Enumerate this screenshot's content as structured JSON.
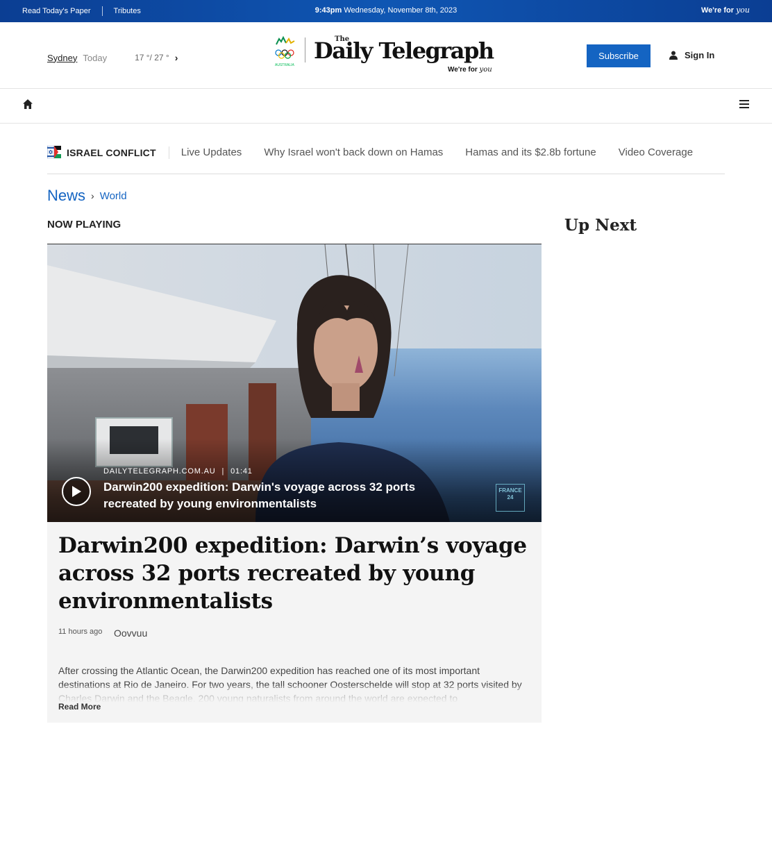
{
  "topbar": {
    "read_paper": "Read Today's Paper",
    "tributes": "Tributes",
    "time": "9:43pm",
    "date": "Wednesday, November 8th, 2023",
    "tagline_prefix": "We're for",
    "tagline_script": "you"
  },
  "masthead": {
    "city": "Sydney",
    "day": "Today",
    "temps": "17 °/ 27 °",
    "olympic_text": "AUSTRALIA",
    "logo_the": "The",
    "logo_name": "Daily Telegraph",
    "logo_tag_prefix": "We're for",
    "logo_tag_script": "you",
    "subscribe": "Subscribe",
    "sign_in": "Sign In"
  },
  "topics": {
    "title": "ISRAEL CONFLICT",
    "links": [
      "Live Updates",
      "Why Israel won't back down on Hamas",
      "Hamas and its $2.8b fortune",
      "Video Coverage"
    ]
  },
  "breadcrumb": {
    "section": "News",
    "subsection": "World"
  },
  "now_playing": "NOW PLAYING",
  "up_next": "Up Next",
  "video": {
    "source": "DAILYTELEGRAPH.COM.AU",
    "duration": "01:41",
    "title": "Darwin200 expedition: Darwin's voyage across 32 ports recreated by young environmentalists",
    "watermark_line1": "FRANCE",
    "watermark_line2": "24"
  },
  "article": {
    "headline": "Darwin200 expedition: Darwin’s voyage across 32 ports recreated by young environmentalists",
    "time": "11 hours ago",
    "source": "Oovvuu",
    "summary": "After crossing the Atlantic Ocean, the Darwin200 expedition has reached one of its most important destinations at Rio de Janeiro. For two years, the tall schooner Oosterschelde will stop at 32 ports visited by Charles Darwin and the Beagle. 200 young naturalists from around the world are expected to",
    "read_more": "Read More"
  },
  "colors": {
    "brand_blue": "#1464c2",
    "topbar_blue": "#0b3e93"
  }
}
